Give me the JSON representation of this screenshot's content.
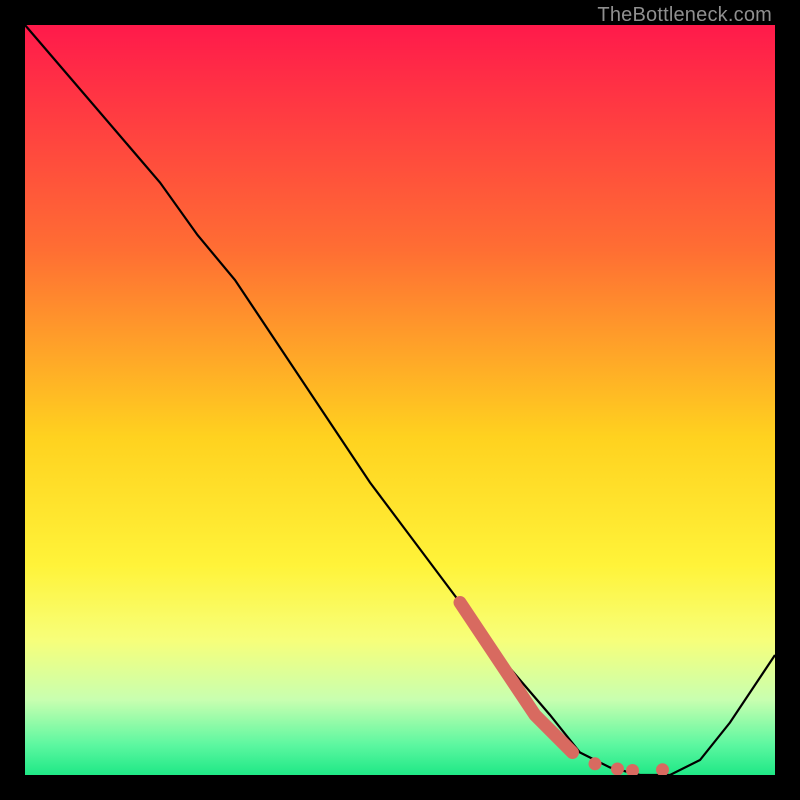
{
  "attribution": "TheBottleneck.com",
  "chart_data": {
    "type": "line",
    "title": "",
    "xlabel": "",
    "ylabel": "",
    "xlim": [
      0,
      100
    ],
    "ylim": [
      0,
      100
    ],
    "grid": false,
    "legend": false,
    "gradient_stops": [
      {
        "offset": 0.0,
        "color": "#ff1a4b"
      },
      {
        "offset": 0.3,
        "color": "#ff6e33"
      },
      {
        "offset": 0.55,
        "color": "#ffd21f"
      },
      {
        "offset": 0.72,
        "color": "#fff339"
      },
      {
        "offset": 0.82,
        "color": "#f7ff7a"
      },
      {
        "offset": 0.9,
        "color": "#c8ffb0"
      },
      {
        "offset": 0.96,
        "color": "#5cf7a0"
      },
      {
        "offset": 1.0,
        "color": "#1fe886"
      }
    ],
    "series": [
      {
        "name": "bottleneck-curve",
        "color": "#000000",
        "x": [
          0,
          6,
          12,
          18,
          23,
          28,
          34,
          40,
          46,
          52,
          58,
          64,
          70,
          74,
          78,
          82,
          86,
          90,
          94,
          100
        ],
        "y": [
          100,
          93,
          86,
          79,
          72,
          66,
          57,
          48,
          39,
          31,
          23,
          15,
          8,
          3,
          1,
          0,
          0,
          2,
          7,
          16
        ]
      }
    ],
    "highlight_segment": {
      "name": "highlight-range",
      "color": "#d86a60",
      "x": [
        58,
        60,
        62,
        64,
        66,
        68,
        70,
        72,
        73
      ],
      "y": [
        23,
        20,
        17,
        14,
        11,
        8,
        6,
        4,
        3
      ]
    },
    "highlight_dots": {
      "name": "highlight-dots",
      "color": "#d86a60",
      "points": [
        {
          "x": 76,
          "y": 1.5
        },
        {
          "x": 79,
          "y": 0.8
        },
        {
          "x": 81,
          "y": 0.6
        },
        {
          "x": 85,
          "y": 0.7
        }
      ]
    }
  }
}
